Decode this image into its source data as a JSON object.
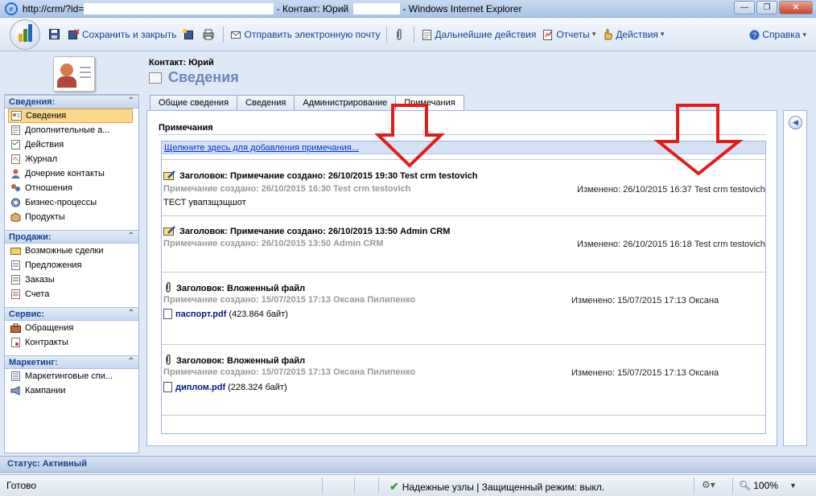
{
  "window": {
    "url": "http://crm/?id=",
    "title_contact": " - Контакт: Юрий",
    "app_name": " - Windows Internet Explorer",
    "minimize": "—",
    "maximize": "❐",
    "close": "✕"
  },
  "toolbar": {
    "save_close": "Сохранить и закрыть",
    "send_email": "Отправить электронную почту",
    "next_actions": "Дальнейшие действия",
    "reports": "Отчеты",
    "actions": "Действия",
    "help": "Справка",
    "dropdown_glyph": "▾"
  },
  "header": {
    "contact": "Контакт: Юрий",
    "title": "Сведения"
  },
  "nav": {
    "groups": [
      {
        "title": "Сведения:",
        "items": [
          "Сведения",
          "Дополнительные а...",
          "Действия",
          "Журнал",
          "Дочерние контакты",
          "Отношения",
          "Бизнес-процессы",
          "Продукты"
        ]
      },
      {
        "title": "Продажи:",
        "items": [
          "Возможные сделки",
          "Предложения",
          "Заказы",
          "Счета"
        ]
      },
      {
        "title": "Сервис:",
        "items": [
          "Обращения",
          "Контракты"
        ]
      },
      {
        "title": "Маркетинг:",
        "items": [
          "Маркетинговые спи...",
          "Кампании"
        ]
      }
    ],
    "collapse_glyph": "⌃"
  },
  "tabs": [
    "Общие сведения",
    "Сведения",
    "Администрирование",
    "Примечания"
  ],
  "notes_section": {
    "title": "Примечания",
    "add_link": "Щелкните здесь для добавления примечания...",
    "notes": [
      {
        "title": "Заголовок: Примечание создано: 26/10/2015 19:30 Test crm testovich",
        "created": "Примечание создано: 26/10/2015 16:30 Test crm testovich",
        "modified": "Изменено: 26/10/2015 16:37 Test crm testovich",
        "body": "ТЕСТ увапзщзщшот"
      },
      {
        "title": "Заголовок: Примечание создано: 26/10/2015 13:50 Admin CRM",
        "created": "Примечание создано: 26/10/2015 13:50 Admin CRM",
        "modified": "Изменено: 26/10/2015 16:18 Test crm testovich"
      },
      {
        "title": "Заголовок: Вложенный файл",
        "created": "Примечание создано: 15/07/2015 17:13 Оксана Пилипенко",
        "modified": "Изменено: 15/07/2015 17:13 Оксана",
        "file_name": "паспорт.pdf",
        "file_size": "(423.864 байт)"
      },
      {
        "title": "Заголовок: Вложенный файл",
        "created": "Примечание создано: 15/07/2015 17:13 Оксана Пилипенко",
        "modified": "Изменено: 15/07/2015 17:13 Оксана",
        "file_name": "диплом.pdf",
        "file_size": "(228.324 байт)"
      }
    ]
  },
  "status": {
    "record": "Статус: Активный",
    "ready": "Готово",
    "zone": "Надежные узлы | Защищенный режим: выкл.",
    "zoom": "100%"
  },
  "colors": {
    "accent": "#15428b",
    "highlight": "#fcd78e",
    "arrow": "#e31b1b"
  }
}
